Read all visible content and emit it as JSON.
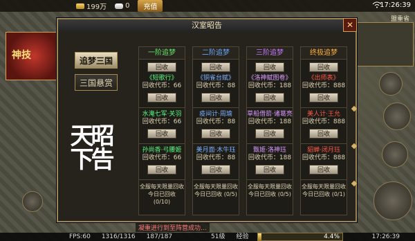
{
  "topbar": {
    "gold": "199万",
    "ingot": "0",
    "recharge": "充值",
    "clock": "17:26:39"
  },
  "promo": {
    "text": "神技"
  },
  "map": {
    "label": "盟重省"
  },
  "dialog": {
    "title": "汉室昭告",
    "close_label": "✕",
    "tabs": [
      "追梦三国",
      "三国悬赏"
    ],
    "calligraphy": "昭告天下",
    "columns": [
      {
        "header": "一阶追梦",
        "header_class": "c1",
        "top_button": "回收",
        "cells": [
          {
            "item": "《短歌行》",
            "color": "green",
            "sub": "回收代币：66",
            "button": "回收"
          },
          {
            "item": "水淹七军·关羽",
            "color": "green",
            "sub": "回收代币：66",
            "button": "回收"
          },
          {
            "item": "孙尚香·弓腰姬",
            "color": "green",
            "sub": "回收代币：66",
            "button": "回收"
          }
        ],
        "footer": [
          "全服每天限量回收",
          "今日已回收  (0/10)"
        ]
      },
      {
        "header": "二阶追梦",
        "header_class": "c2",
        "top_button": "回收",
        "cells": [
          {
            "item": "《铜雀台赋》",
            "color": "blue",
            "sub": "回收代币：88",
            "button": "回收"
          },
          {
            "item": "疫间计·周瑜",
            "color": "blue",
            "sub": "回收代币：88",
            "button": "回收"
          },
          {
            "item": "美月面·木牛珏",
            "color": "blue",
            "sub": "回收代币：88",
            "button": "回收"
          }
        ],
        "footer": [
          "全服每天限量回收",
          "今日已回收  (0/5)"
        ]
      },
      {
        "header": "三阶追梦",
        "header_class": "c3",
        "top_button": "回收",
        "cells": [
          {
            "item": "《洛神赋图卷》",
            "color": "purple",
            "sub": "回收代币：188",
            "button": "回收"
          },
          {
            "item": "草船借箭·诸葛亮",
            "color": "purple",
            "sub": "回收代币：188",
            "button": "回收"
          },
          {
            "item": "甄姬·洛神珏",
            "color": "purple",
            "sub": "回收代币：188",
            "button": "回收"
          }
        ],
        "footer": [
          "全服每天限量回收",
          "今日已回收  (0/5)"
        ]
      },
      {
        "header": "终极追梦",
        "header_class": "c4",
        "top_button": "回收",
        "cells": [
          {
            "item": "《出师表》",
            "color": "orange",
            "sub": "回收代币：888",
            "button": "回收"
          },
          {
            "item": "美人计·王允",
            "color": "orange",
            "sub": "回收代币：888",
            "button": "回收"
          },
          {
            "item": "貂蝉·闭月珏",
            "color": "orange",
            "sub": "回收代币：888",
            "button": "回收"
          }
        ],
        "footer": [
          "全服每天限量回收",
          "今日已回收  (0/1)"
        ]
      }
    ]
  },
  "status": {
    "fps": "FPS:60",
    "hp": "1316/1316",
    "mp": "187/187",
    "level": "51级",
    "exp_label": "经验",
    "exp_percent": "4.4%",
    "time": "17:26:39"
  },
  "marquee": "凝重进行到至阵营成功..."
}
